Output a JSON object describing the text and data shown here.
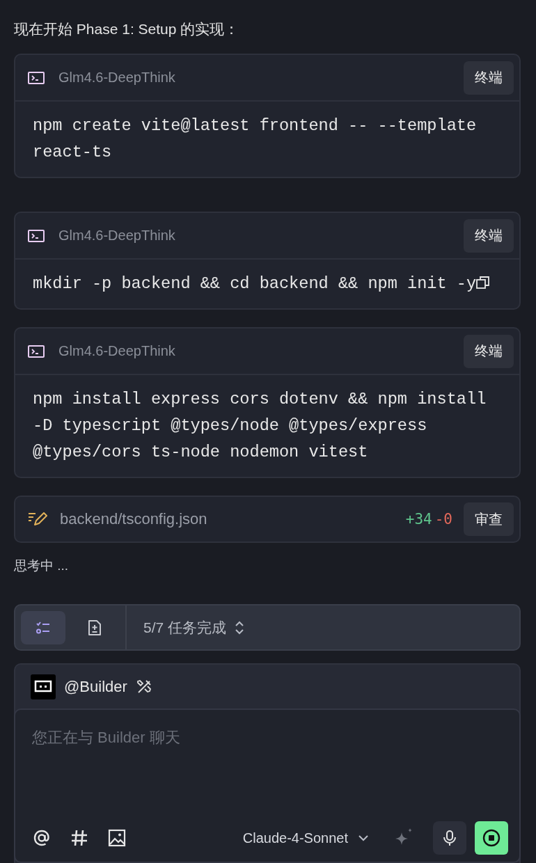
{
  "intro": "现在开始 Phase 1: Setup 的实现：",
  "commands": [
    {
      "source": "Glm4.6-DeepThink",
      "button": "终端",
      "code": "npm create vite@latest frontend -- --template react-ts",
      "copy_visible": false
    },
    {
      "source": "Glm4.6-DeepThink",
      "button": "终端",
      "code": "mkdir -p backend && cd backend && npm init -y",
      "copy_visible": true
    },
    {
      "source": "Glm4.6-DeepThink",
      "button": "终端",
      "code": "npm install express cors dotenv && npm install -D typescript @types/node @types/express @types/cors ts-node nodemon vitest",
      "copy_visible": false
    }
  ],
  "file_change": {
    "path": "backend/tsconfig.json",
    "added": "+34",
    "removed": "-0",
    "button": "审查"
  },
  "status": "思考中 ...",
  "task_bar": {
    "tabs": [
      {
        "kind": "checklist",
        "selected": true
      },
      {
        "kind": "file",
        "selected": false
      }
    ],
    "progress": "5/7 任务完成"
  },
  "chat": {
    "agent": "@Builder",
    "placeholder": "您正在与 Builder 聊天",
    "model": "Claude-4-Sonnet"
  }
}
